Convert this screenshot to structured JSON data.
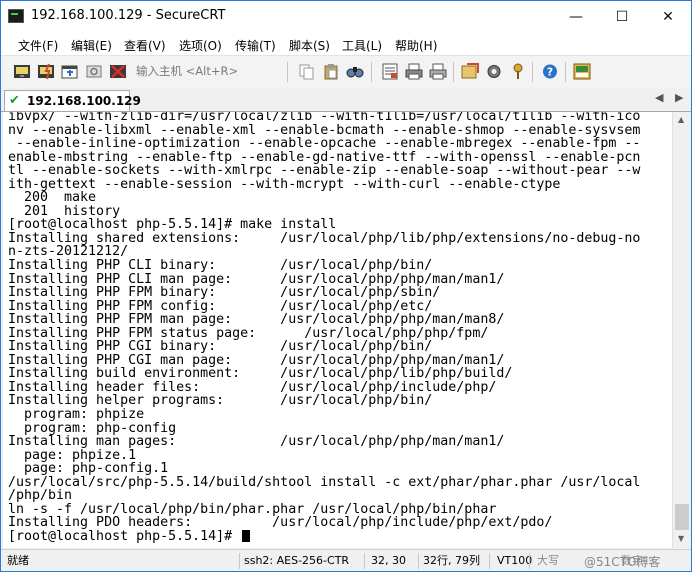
{
  "window": {
    "title": "192.168.100.129 - SecureCRT"
  },
  "menu": {
    "file": "文件(F)",
    "edit": "编辑(E)",
    "view": "查看(V)",
    "options": "选项(O)",
    "transfer": "传输(T)",
    "script": "脚本(S)",
    "tools": "工具(L)",
    "help": "帮助(H)"
  },
  "toolbar": {
    "quick_connect_placeholder": "输入主机 <Alt+R>"
  },
  "tab": {
    "label": "192.168.100.129",
    "status_icon": "check-icon"
  },
  "terminal": {
    "lines": [
      "ibvpx/ --with-zlib-dir=/usr/local/zlib --with-t1lib=/usr/local/t1lib --with-ico",
      "nv --enable-libxml --enable-xml --enable-bcmath --enable-shmop --enable-sysvsem",
      " --enable-inline-optimization --enable-opcache --enable-mbregex --enable-fpm --",
      "enable-mbstring --enable-ftp --enable-gd-native-ttf --with-openssl --enable-pcn",
      "tl --enable-sockets --with-xmlrpc --enable-zip --enable-soap --without-pear --w",
      "ith-gettext --enable-session --with-mcrypt --with-curl --enable-ctype",
      "  200  make",
      "  201  history",
      "[root@localhost php-5.5.14]# make install",
      "Installing shared extensions:     /usr/local/php/lib/php/extensions/no-debug-no",
      "n-zts-20121212/",
      "Installing PHP CLI binary:        /usr/local/php/bin/",
      "Installing PHP CLI man page:      /usr/local/php/php/man/man1/",
      "Installing PHP FPM binary:        /usr/local/php/sbin/",
      "Installing PHP FPM config:        /usr/local/php/etc/",
      "Installing PHP FPM man page:      /usr/local/php/php/man/man8/",
      "Installing PHP FPM status page:      /usr/local/php/php/fpm/",
      "Installing PHP CGI binary:        /usr/local/php/bin/",
      "Installing PHP CGI man page:      /usr/local/php/php/man/man1/",
      "Installing build environment:     /usr/local/php/lib/php/build/",
      "Installing header files:          /usr/local/php/include/php/",
      "Installing helper programs:       /usr/local/php/bin/",
      "  program: phpize",
      "  program: php-config",
      "Installing man pages:             /usr/local/php/php/man/man1/",
      "  page: phpize.1",
      "  page: php-config.1",
      "/usr/local/src/php-5.5.14/build/shtool install -c ext/phar/phar.phar /usr/local",
      "/php/bin",
      "ln -s -f /usr/local/php/bin/phar.phar /usr/local/php/bin/phar",
      "Installing PDO headers:          /usr/local/php/include/php/ext/pdo/"
    ],
    "prompt": "[root@localhost php-5.5.14]# "
  },
  "status": {
    "ready": "就绪",
    "cipher": "ssh2: AES-256-CTR",
    "cursor_pos": "32,  30",
    "size": "32行, 79列",
    "emulation": "VT100",
    "caps": "大写",
    "num": "数字",
    "watermark": "@51CTO博客"
  }
}
